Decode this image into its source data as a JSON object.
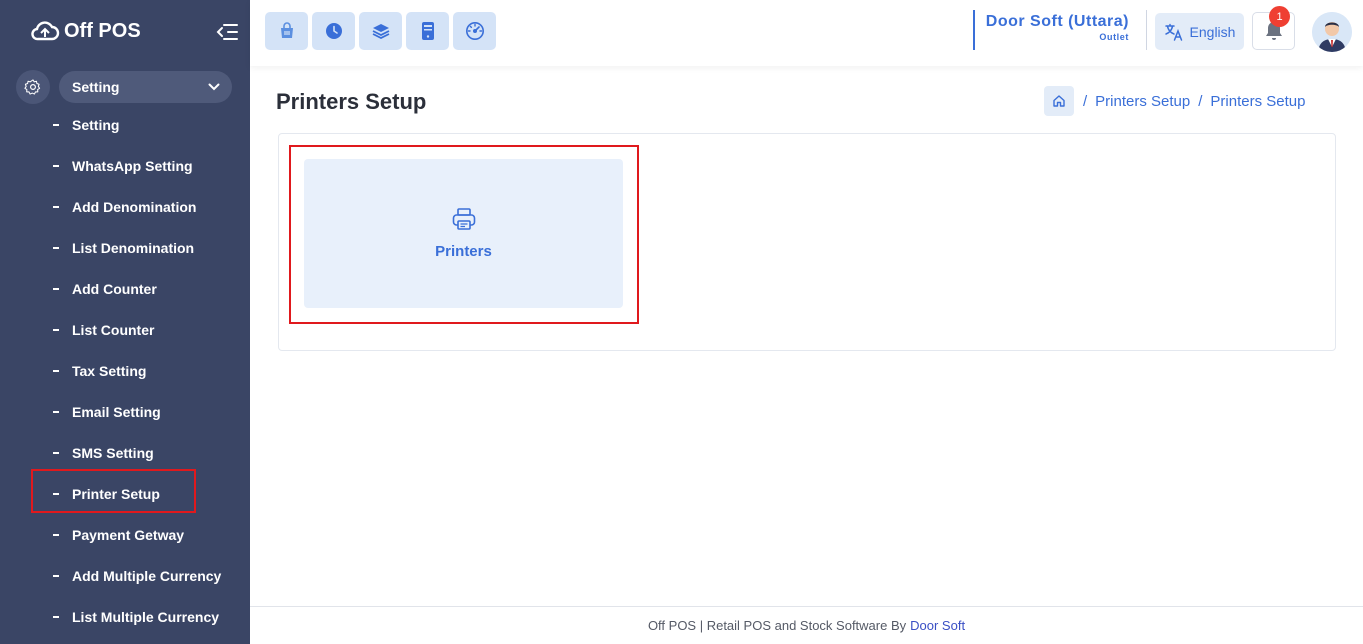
{
  "app": {
    "name": "Off POS",
    "colors": {
      "sidebar": "#3a4565",
      "accent": "#3a6fd8",
      "highlight": "#e0191d"
    }
  },
  "sidebar": {
    "section_label": "Setting",
    "items": [
      {
        "label": "Setting"
      },
      {
        "label": "WhatsApp Setting"
      },
      {
        "label": "Add Denomination"
      },
      {
        "label": "List Denomination"
      },
      {
        "label": "Add Counter"
      },
      {
        "label": "List Counter"
      },
      {
        "label": "Tax Setting"
      },
      {
        "label": "Email Setting"
      },
      {
        "label": "SMS Setting"
      },
      {
        "label": "Printer Setup"
      },
      {
        "label": "Payment Getway"
      },
      {
        "label": "Add Multiple Currency"
      },
      {
        "label": "List Multiple Currency"
      }
    ]
  },
  "topbar": {
    "tool_icons": [
      "pos-basket-icon",
      "clock-icon",
      "layers-icon",
      "tablet-icon",
      "dashboard-gauge-icon"
    ],
    "company_name": "Door Soft (Uttara)",
    "company_sub": "Outlet",
    "language": "English",
    "notification_count": "1"
  },
  "page": {
    "title": "Printers Setup",
    "breadcrumb": [
      "Printers Setup",
      "Printers Setup"
    ],
    "tile_label": "Printers"
  },
  "footer": {
    "text": "Off POS | Retail POS and Stock Software By",
    "link": "Door Soft"
  }
}
